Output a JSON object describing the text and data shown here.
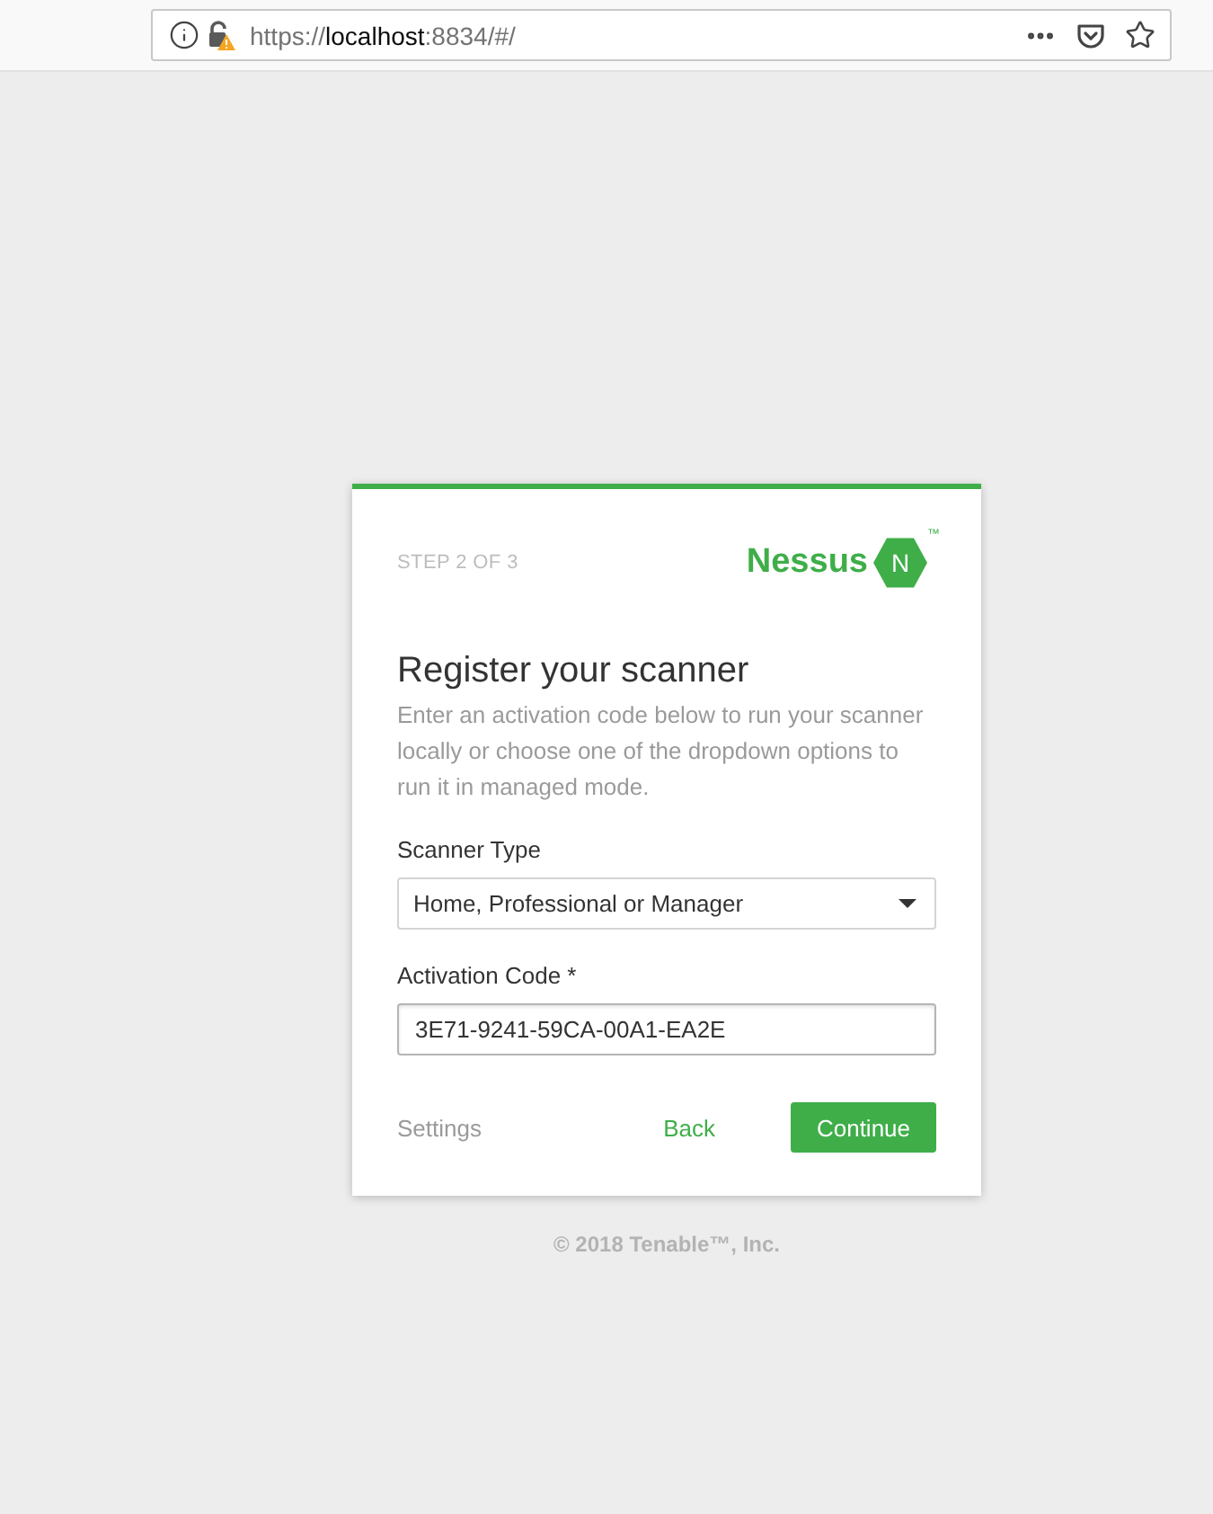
{
  "browser": {
    "url": {
      "scheme": "https://",
      "host": "localhost",
      "rest": ":8834/#/"
    }
  },
  "card": {
    "step": "STEP 2 OF 3",
    "logo": {
      "wordmark": "Nessus",
      "badge_letter": "N",
      "trademark": "™"
    },
    "title": "Register your scanner",
    "description": "Enter an activation code below to run your scanner locally or choose one of the dropdown options to run it in managed mode.",
    "fields": [
      {
        "kind": "select",
        "label": "Scanner Type",
        "value": "Home, Professional or Manager"
      },
      {
        "kind": "text",
        "label": "Activation Code *",
        "value": "3E71-9241-59CA-00A1-EA2E"
      }
    ],
    "actions": [
      {
        "kind": "link",
        "label": "Settings"
      },
      {
        "kind": "secondary",
        "label": "Back"
      },
      {
        "kind": "primary",
        "label": "Continue"
      }
    ]
  },
  "footer": "© 2018 Tenable™, Inc."
}
